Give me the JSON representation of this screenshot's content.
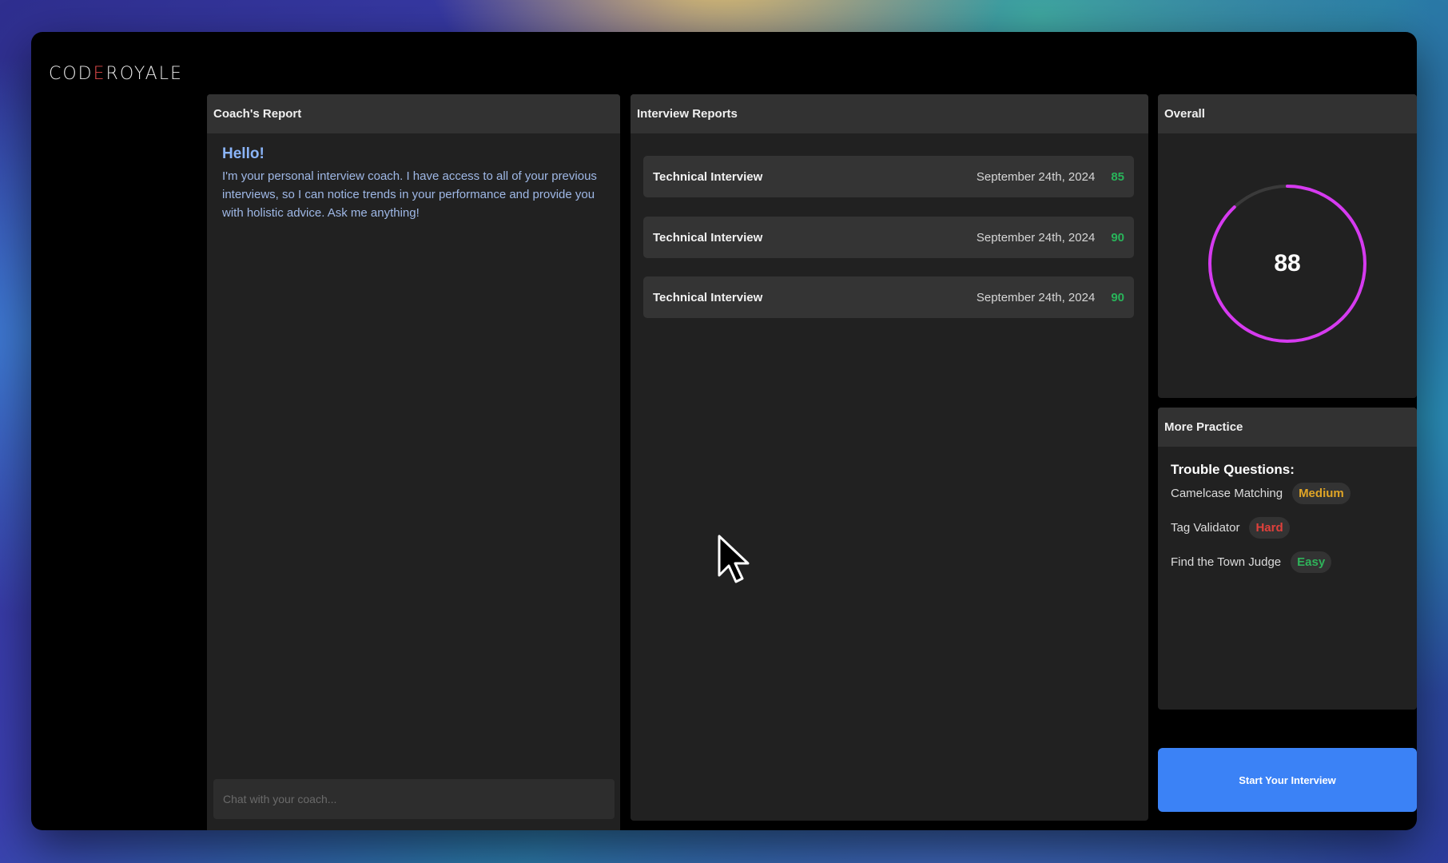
{
  "app": {
    "logo_main": "CODEROYALE",
    "logo_parts": [
      "COD",
      "E",
      "ROYALE"
    ]
  },
  "coach": {
    "header": "Coach's Report",
    "greeting": "Hello!",
    "message": "I'm your personal interview coach. I have access to all of your previous interviews, so I can notice trends in your performance and provide you with holistic advice. Ask me anything!",
    "input_placeholder": "Chat with your coach..."
  },
  "reports": {
    "header": "Interview Reports",
    "items": [
      {
        "title": "Technical Interview",
        "date": "September 24th, 2024",
        "score": "85"
      },
      {
        "title": "Technical Interview",
        "date": "September 24th, 2024",
        "score": "90"
      },
      {
        "title": "Technical Interview",
        "date": "September 24th, 2024",
        "score": "90"
      }
    ]
  },
  "overall": {
    "header": "Overall",
    "score": "88",
    "progress_fraction": 0.88,
    "gauge_color": "#d63af0",
    "track_color": "#3a3a3a"
  },
  "practice": {
    "header": "More Practice",
    "subtitle": "Trouble Questions:",
    "questions": [
      {
        "name": "Camelcase Matching",
        "difficulty": "Medium",
        "color": "#e0a526"
      },
      {
        "name": "Tag Validator",
        "difficulty": "Hard",
        "color": "#e0403b"
      },
      {
        "name": "Find the Town Judge",
        "difficulty": "Easy",
        "color": "#2fb35a"
      }
    ]
  },
  "actions": {
    "start_label": "Start Your Interview",
    "accent": "#3b82f6"
  },
  "colors": {
    "score_green": "#29b35a",
    "greeting_blue": "#8ab4f8"
  }
}
